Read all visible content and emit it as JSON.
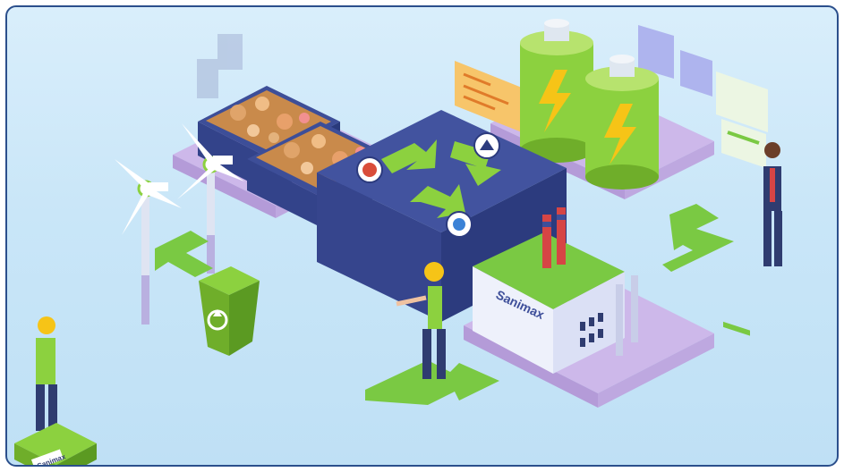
{
  "scene": {
    "description_text": "",
    "factory_brand": "Sanimax",
    "bin_label": "Sanimax",
    "colors": {
      "frame_border": "#2b4f8c",
      "background": "#cfe9f9",
      "platform_lilac": "#cdb8ea",
      "recycler_blue": "#3e4f9a",
      "accent_green": "#7ac943",
      "battery_green": "#8cd13f",
      "factory_white": "#eef1fb",
      "hardhat_yellow": "#f6c417"
    },
    "icons": [
      "recycle-arrows-icon",
      "lightning-bolt-icon",
      "recycle-symbol-icon",
      "wind-turbine-icon",
      "arrow-icon"
    ]
  }
}
